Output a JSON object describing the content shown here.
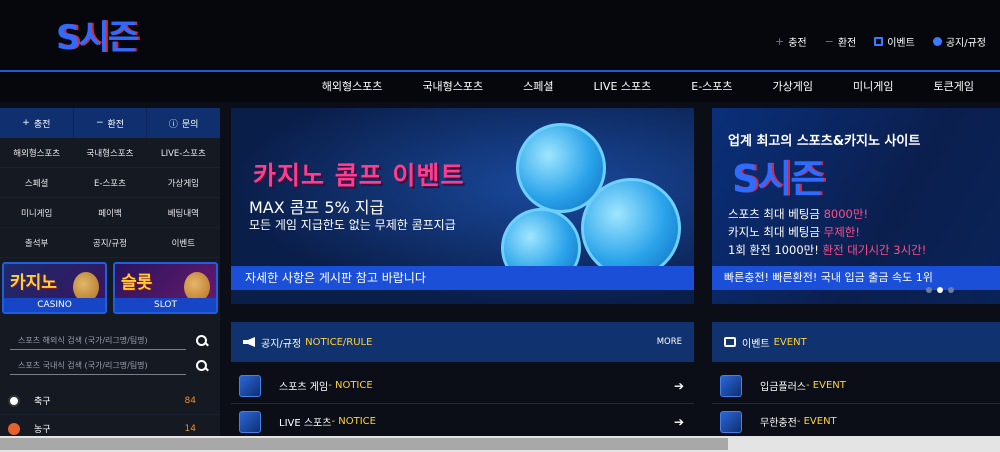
{
  "header": {
    "logo_text": "S시즌",
    "links": [
      {
        "icon": "plus-icon",
        "label": "충전"
      },
      {
        "icon": "minus-icon",
        "label": "환전"
      },
      {
        "icon": "calendar-icon",
        "label": "이벤트"
      },
      {
        "icon": "info-icon",
        "label": "공지/규정"
      }
    ]
  },
  "nav": {
    "items": [
      "해외형스포츠",
      "국내형스포츠",
      "스페셜",
      "LIVE 스포츠",
      "E-스포츠",
      "가상게임",
      "미니게임",
      "토큰게임"
    ]
  },
  "sidebar": {
    "buttons": [
      {
        "icon": "plus-icon",
        "label": "충전"
      },
      {
        "icon": "minus-icon",
        "label": "환전"
      },
      {
        "icon": "info-icon",
        "label": "문의"
      }
    ],
    "grid": [
      "해외형스포츠",
      "국내형스포츠",
      "LIVE-스포츠",
      "스페셜",
      "E-스포츠",
      "가상게임",
      "미니게임",
      "페이백",
      "베팅내역",
      "출석부",
      "공지/규정",
      "이벤트"
    ],
    "promos": [
      {
        "title": "카지노",
        "sub": "CASINO"
      },
      {
        "title": "슬롯",
        "sub": "SLOT"
      }
    ],
    "search": [
      {
        "placeholder": "스포츠 해외식 검색 (국가/리그명/팀명)"
      },
      {
        "placeholder": "스포츠 국내식 검색 (국가/리그명/팀명)"
      }
    ],
    "sports": [
      {
        "name": "축구",
        "count": "84",
        "icon": "soccer-ball-icon"
      },
      {
        "name": "농구",
        "count": "14",
        "icon": "basketball-icon"
      }
    ]
  },
  "banner_main": {
    "title": "카지노 콤프 이벤트",
    "line1": "MAX 콤프 5% 지급",
    "line2": "모든 게임 지급한도 없는 무제한 콤프지급",
    "bar": "자세한 사항은 게시판 참고 바랍니다"
  },
  "banner_side": {
    "headline": "업계 최고의 스포츠&카지노 사이트",
    "logo": "S시즌",
    "l1a": "스포츠 최대 베팅금 ",
    "l1b": "8000만!",
    "l2a": "카지노 최대 베팅금 ",
    "l2b": "무제한!",
    "l3a": "1회 환전 1000만! ",
    "l3b": "환전 대기시간 3시간!",
    "bar": "빠른충전! 빠른환전!  국내 입금 출금 속도 1위"
  },
  "notice": {
    "title": "공지/규정",
    "title_en": "NOTICE/RULE",
    "more": "MORE",
    "rows": [
      {
        "title": "스포츠 게임",
        "tag": "- NOTICE"
      },
      {
        "title": "LIVE 스포츠",
        "tag": " - NOTICE"
      }
    ]
  },
  "event": {
    "title": "이벤트",
    "title_en": "EVENT",
    "rows": [
      {
        "title": "입금플러스",
        "tag": " - EVENT"
      },
      {
        "title": "무한충전",
        "tag": " - EVENT"
      }
    ]
  }
}
